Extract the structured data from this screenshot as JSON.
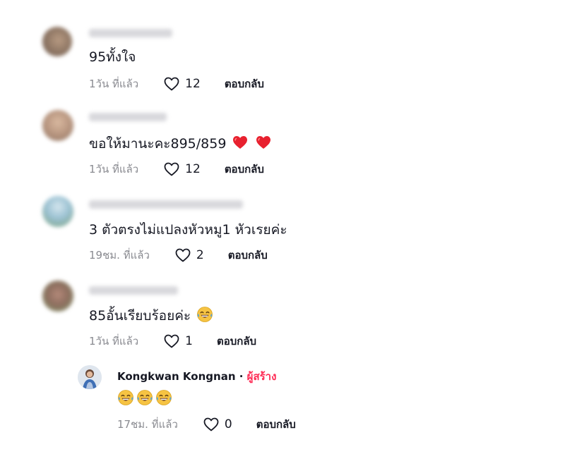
{
  "comments": [
    {
      "text": "95ทั้งใจ",
      "time": "1วัน ที่แล้ว",
      "likes": "12",
      "reply_label": "ตอบกลับ"
    },
    {
      "text": "ขอให้มานะคะ895/859",
      "emoji": [
        "heart-emoji",
        "heart-emoji"
      ],
      "time": "1วัน ที่แล้ว",
      "likes": "12",
      "reply_label": "ตอบกลับ"
    },
    {
      "text": "3 ตัวตรงไม่แปลงหัวหมู1 หัวเรยค่ะ",
      "time": "19ชม. ที่แล้ว",
      "likes": "2",
      "reply_label": "ตอบกลับ"
    },
    {
      "text": "85อั้นเรียบร้อยค่ะ",
      "emoji": [
        "tears-of-joy-emoji"
      ],
      "time": "1วัน ที่แล้ว",
      "likes": "1",
      "reply_label": "ตอบกลับ"
    }
  ],
  "reply": {
    "author": "Kongkwan Kongnan",
    "separator": "·",
    "creator_tag": "ผู้สร้าง",
    "emoji": [
      "tears-of-joy-emoji",
      "tears-of-joy-emoji",
      "tears-of-joy-emoji"
    ],
    "time": "17ชม. ที่แล้ว",
    "likes": "0",
    "reply_label": "ตอบกลับ"
  },
  "colors": {
    "text": "#161823",
    "secondary": "#8a8b91",
    "creator_accent": "#fe2c55",
    "heart_emoji": "#e8212f",
    "emoji_face": "#f6c343"
  }
}
